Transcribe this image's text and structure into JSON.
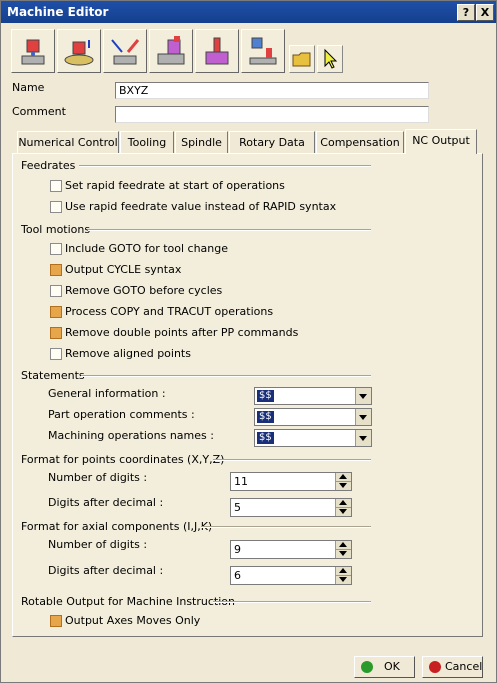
{
  "window": {
    "title": "Machine Editor",
    "help_label": "?",
    "close_label": "X"
  },
  "toolbar": {
    "tools": [
      "3-axis-machine-icon",
      "rotary-table-machine-icon",
      "5-axis-machine-icon",
      "horizontal-lathe-icon",
      "vertical-lathe-icon",
      "mill-turn-icon"
    ],
    "open_icon": "folder-icon",
    "select_icon": "pointer-icon"
  },
  "header": {
    "name_label": "Name",
    "name_value": "BXYZ",
    "comment_label": "Comment",
    "comment_value": ""
  },
  "tabs": [
    "Numerical Control",
    "Tooling",
    "Spindle",
    "Rotary Data",
    "Compensation",
    "NC Output"
  ],
  "active_tab": "NC Output",
  "feedrates": {
    "title": "Feedrates",
    "options": [
      {
        "label": "Set rapid feedrate at start of operations",
        "checked": false
      },
      {
        "label": "Use rapid feedrate value instead of RAPID syntax",
        "checked": false
      }
    ]
  },
  "tool_motions": {
    "title": "Tool motions",
    "options": [
      {
        "label": "Include GOTO for tool change",
        "checked": false
      },
      {
        "label": "Output CYCLE syntax",
        "checked": true
      },
      {
        "label": "Remove GOTO before cycles",
        "checked": false
      },
      {
        "label": "Process COPY and TRACUT operations",
        "checked": true
      },
      {
        "label": "Remove double points after PP commands",
        "checked": true
      },
      {
        "label": "Remove aligned points",
        "checked": false
      }
    ]
  },
  "statements": {
    "title": "Statements",
    "rows": [
      {
        "label": "General information :",
        "value": "$$"
      },
      {
        "label": "Part operation comments :",
        "value": "$$"
      },
      {
        "label": "Machining operations names :",
        "value": "$$"
      }
    ]
  },
  "points_format": {
    "title": "Format for points coordinates (X,Y,Z)",
    "digits_label": "Number of digits :",
    "digits_value": "11",
    "decimal_label": "Digits after decimal :",
    "decimal_value": "5"
  },
  "axial_format": {
    "title": "Format for axial components (I,J,K)",
    "digits_label": "Number of digits :",
    "digits_value": "9",
    "decimal_label": "Digits after decimal :",
    "decimal_value": "6"
  },
  "rotable": {
    "title": "Rotable Output for Machine Instruction",
    "option": {
      "label": "Output Axes Moves Only",
      "checked": true
    }
  },
  "buttons": {
    "ok_label": "OK",
    "cancel_label": "Cancel"
  },
  "colors": {
    "titlebar": "#1f4fa8",
    "checked": "#e8a64a",
    "ok": "#2a9a2a",
    "cancel": "#c82020"
  }
}
